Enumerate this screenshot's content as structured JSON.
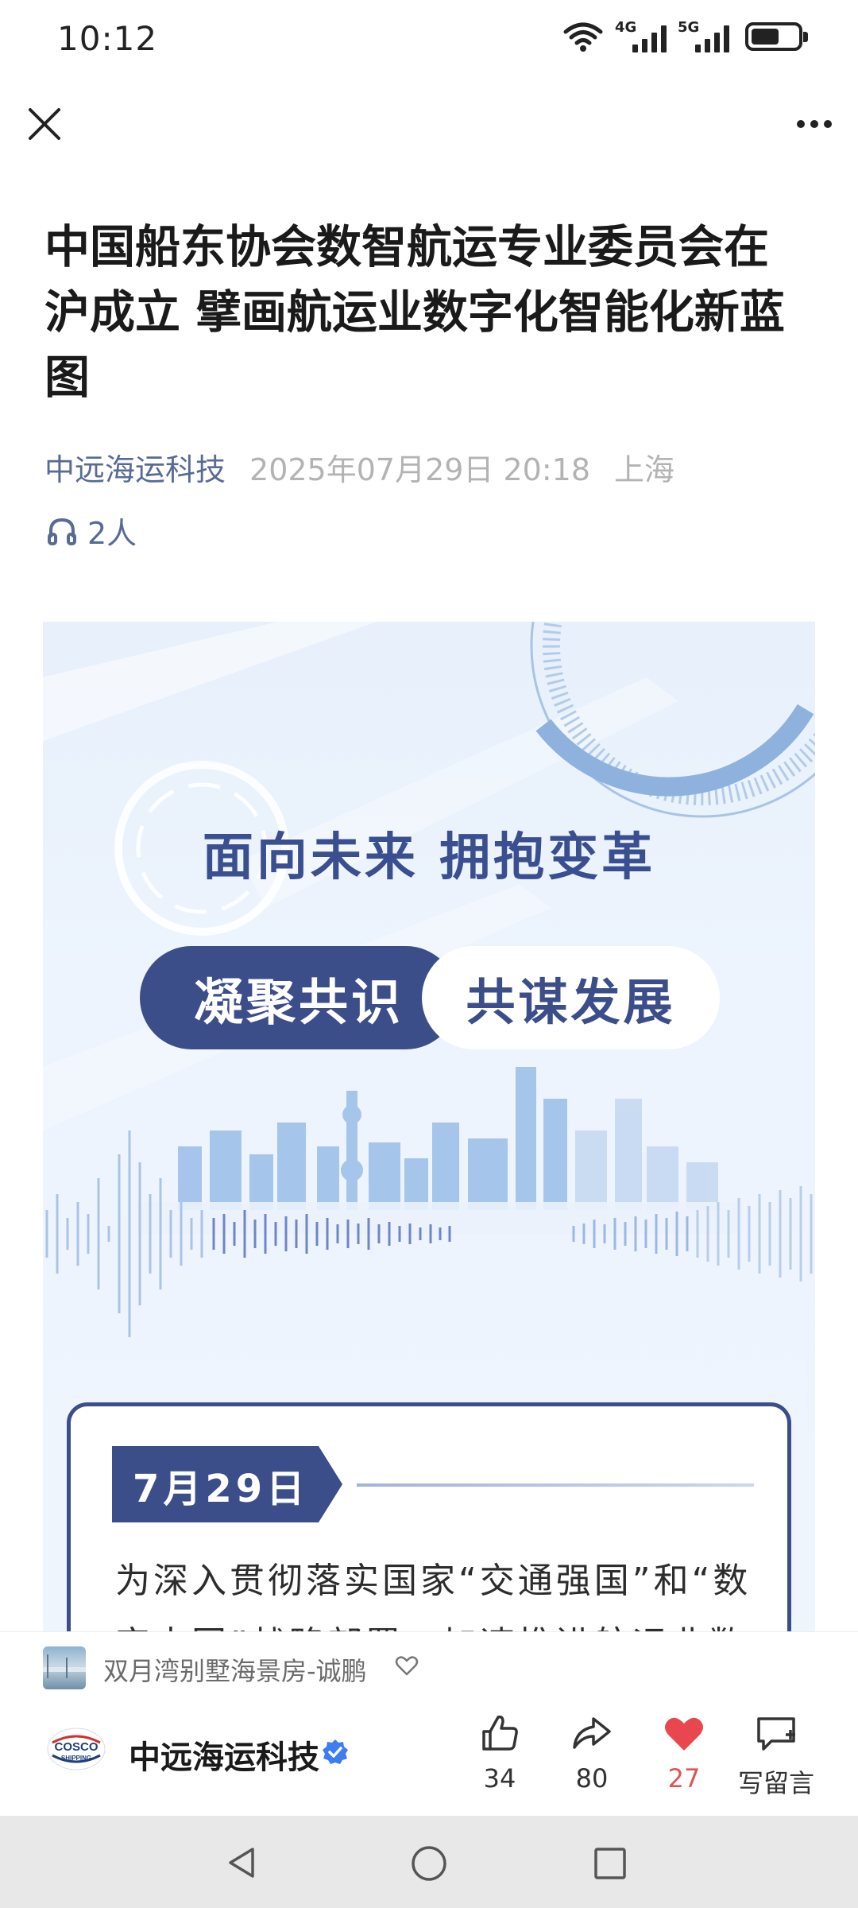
{
  "status_bar": {
    "time": "10:12",
    "signal_1_label": "4G",
    "signal_2_label": "5G"
  },
  "article": {
    "title": "中国船东协会数智航运专业委员会在沪成立 擘画航运业数字化智能化新蓝图",
    "author": "中远海运科技",
    "datetime": "2025年07月29日 20:18",
    "location": "上海",
    "listeners": "2人"
  },
  "poster": {
    "headline": "面向未来  拥抱变革",
    "pill_left": "凝聚共识",
    "pill_right": "共谋发展",
    "date_tag": "7月29日",
    "body_text": "为深入贯彻落实国家“交通强国”和“数字中国”战略部署，加速推进航运业数"
  },
  "music_bar": {
    "track": "双月湾别墅海景房-诚鹏"
  },
  "action_bar": {
    "account_name": "中远海运科技",
    "logo_text": "COSCO",
    "logo_subtext": "SHIPPING",
    "like_count": "34",
    "share_count": "80",
    "heart_count": "27",
    "comment_label": "写留言"
  },
  "colors": {
    "accent_navy": "#3b4e89",
    "link_blue": "#576b95",
    "heart_red": "#e05353",
    "verified_blue": "#3d7df2"
  },
  "icons": [
    "wifi-icon",
    "signal-icon",
    "battery-icon",
    "close-icon",
    "more-icon",
    "headphones-icon",
    "heart-outline-icon",
    "verified-icon",
    "thumbs-up-icon",
    "share-icon",
    "heart-icon",
    "comment-icon",
    "back-nav-icon",
    "home-nav-icon",
    "recents-nav-icon"
  ]
}
